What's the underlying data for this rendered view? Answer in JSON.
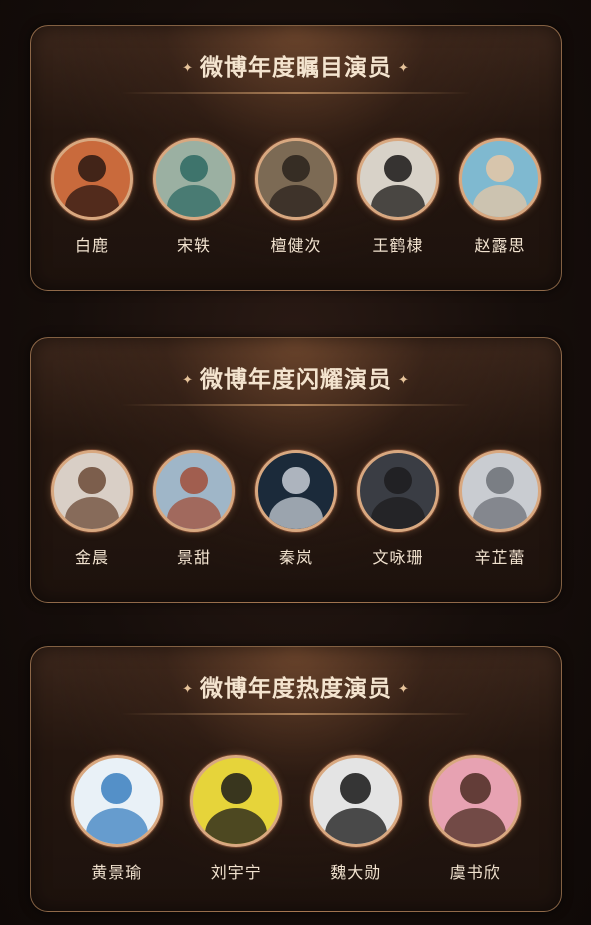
{
  "sections": [
    {
      "title": "微博年度瞩目演员",
      "actors": [
        {
          "name": "白鹿",
          "bg": "#c96a3c",
          "fg": "#2a1712"
        },
        {
          "name": "宋轶",
          "bg": "#9bb0a2",
          "fg": "#2e6a63"
        },
        {
          "name": "檀健次",
          "bg": "#7c6a54",
          "fg": "#2a221c"
        },
        {
          "name": "王鹤棣",
          "bg": "#d8d2c8",
          "fg": "#1a1716"
        },
        {
          "name": "赵露思",
          "bg": "#7fb9d0",
          "fg": "#e6c7a6"
        }
      ]
    },
    {
      "title": "微博年度闪耀演员",
      "actors": [
        {
          "name": "金晨",
          "bg": "#d9cfc6",
          "fg": "#6b4a36"
        },
        {
          "name": "景甜",
          "bg": "#9fb6c8",
          "fg": "#a14f39"
        },
        {
          "name": "秦岚",
          "bg": "#1b2a3a",
          "fg": "#c7cdd6"
        },
        {
          "name": "文咏珊",
          "bg": "#3a3d44",
          "fg": "#1d1c1e"
        },
        {
          "name": "辛芷蕾",
          "bg": "#c9ccd1",
          "fg": "#6c7077"
        }
      ]
    },
    {
      "title": "微博年度热度演员",
      "actors": [
        {
          "name": "黄景瑜",
          "bg": "#e9f1f7",
          "fg": "#3a7fc0"
        },
        {
          "name": "刘宇宁",
          "bg": "#e6d43a",
          "fg": "#1a1a1a"
        },
        {
          "name": "魏大勋",
          "bg": "#e4e4e4",
          "fg": "#161616"
        },
        {
          "name": "虞书欣",
          "bg": "#e7a2b2",
          "fg": "#4b2c22"
        }
      ]
    }
  ],
  "star_glyph": "✦"
}
